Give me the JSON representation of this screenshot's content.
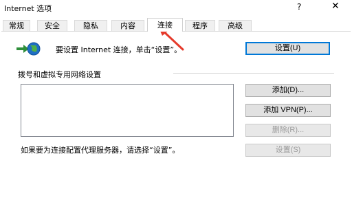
{
  "window": {
    "title": "Internet 选项",
    "help_icon": "?",
    "close_icon": "✕"
  },
  "tabs": [
    {
      "label": "常规"
    },
    {
      "label": "安全"
    },
    {
      "label": "隐私"
    },
    {
      "label": "内容"
    },
    {
      "label": "连接",
      "active": true
    },
    {
      "label": "程序"
    },
    {
      "label": "高级"
    }
  ],
  "setup": {
    "text": "要设置 Internet 连接，单击“设置”。",
    "button_label": "设置(U)"
  },
  "dialup": {
    "section_label": "拨号和虚拟专用网络设置",
    "add_label": "添加(D)...",
    "add_vpn_label": "添加 VPN(P)...",
    "remove_label": "删除(R)...",
    "settings_label": "设置(S)"
  },
  "proxy": {
    "text": "如果要为连接配置代理服务器，请选择“设置”。"
  },
  "colors": {
    "accent": "#0078d7",
    "annotation_arrow": "#e53a2b"
  },
  "icons": {
    "globe": "globe-network-icon",
    "annotation": "red-arrow-annotation"
  }
}
